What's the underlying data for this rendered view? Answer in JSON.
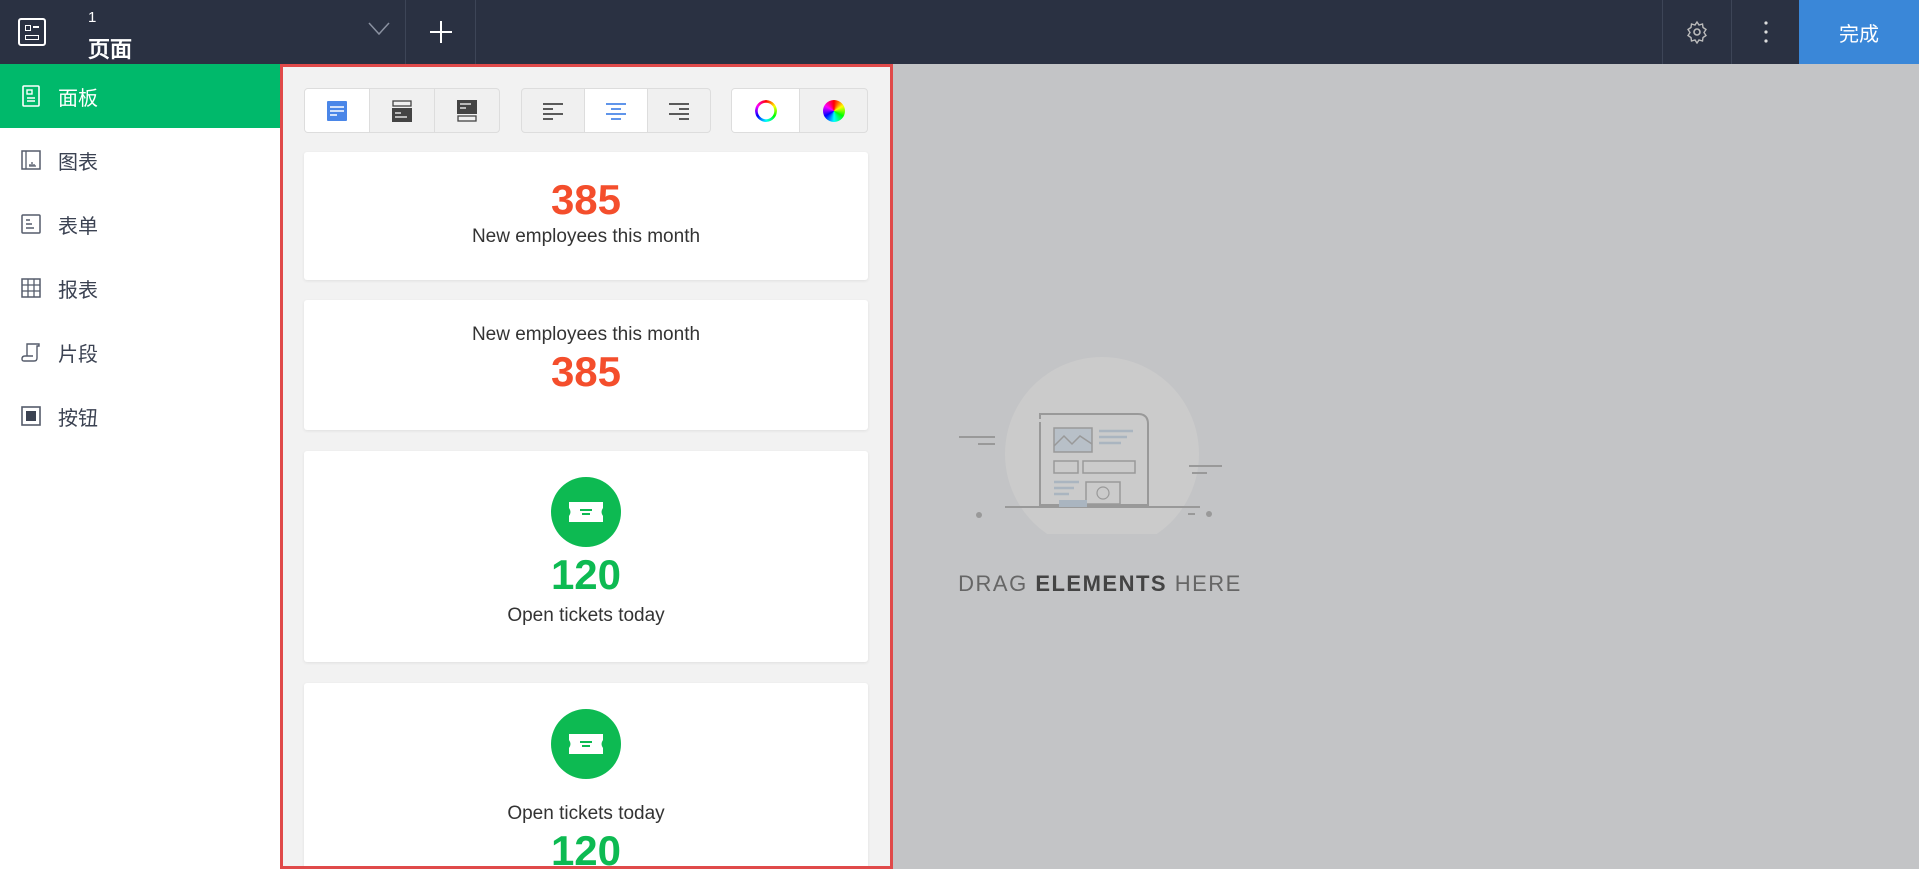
{
  "header": {
    "page_number": "1",
    "page_title": "页面",
    "done_label": "完成"
  },
  "sidebar": {
    "items": [
      {
        "label": "面板",
        "icon": "dashboard-icon"
      },
      {
        "label": "图表",
        "icon": "chart-icon"
      },
      {
        "label": "表单",
        "icon": "form-icon"
      },
      {
        "label": "报表",
        "icon": "report-icon"
      },
      {
        "label": "片段",
        "icon": "snippet-icon"
      },
      {
        "label": "按钮",
        "icon": "button-icon"
      }
    ]
  },
  "cards": [
    {
      "value": "385",
      "label": "New employees this month",
      "color": "#f44e2c"
    },
    {
      "value": "385",
      "label": "New employees this month",
      "color": "#f44e2c"
    },
    {
      "value": "120",
      "label": "Open tickets today",
      "color": "#0dba52"
    },
    {
      "value": "120",
      "label": "Open tickets today",
      "color": "#0dba52"
    }
  ],
  "canvas": {
    "drag_1": "DRAG ",
    "drag_2": "ELEMENTS",
    "drag_3": " HERE"
  },
  "colors": {
    "accent": "#3a87d8",
    "active": "#00b96b",
    "highlight": "#e04a4a"
  }
}
